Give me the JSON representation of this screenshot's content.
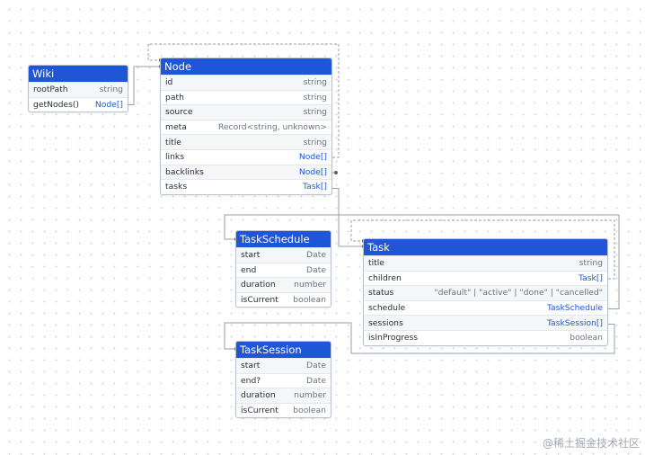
{
  "entities": {
    "wiki": {
      "title": "Wiki",
      "fields": [
        {
          "name": "rootPath",
          "type": "string"
        },
        {
          "name": "getNodes()",
          "type": "Node[]"
        }
      ]
    },
    "node": {
      "title": "Node",
      "fields": [
        {
          "name": "id",
          "type": "string"
        },
        {
          "name": "path",
          "type": "string"
        },
        {
          "name": "source",
          "type": "string"
        },
        {
          "name": "meta",
          "type": "Record<string, unknown>"
        },
        {
          "name": "title",
          "type": "string"
        },
        {
          "name": "links",
          "type": "Node[]"
        },
        {
          "name": "backlinks",
          "type": "Node[]"
        },
        {
          "name": "tasks",
          "type": "Task[]"
        }
      ]
    },
    "task_schedule": {
      "title": "TaskSchedule",
      "fields": [
        {
          "name": "start",
          "type": "Date"
        },
        {
          "name": "end",
          "type": "Date"
        },
        {
          "name": "duration",
          "type": "number"
        },
        {
          "name": "isCurrent",
          "type": "boolean"
        }
      ]
    },
    "task": {
      "title": "Task",
      "fields": [
        {
          "name": "title",
          "type": "string"
        },
        {
          "name": "children",
          "type": "Task[]"
        },
        {
          "name": "status",
          "type": "\"default\" | \"active\" | \"done\" | \"cancelled\""
        },
        {
          "name": "schedule",
          "type": "TaskSchedule"
        },
        {
          "name": "sessions",
          "type": "TaskSession[]"
        },
        {
          "name": "isInProgress",
          "type": "boolean"
        }
      ]
    },
    "task_session": {
      "title": "TaskSession",
      "fields": [
        {
          "name": "start",
          "type": "Date"
        },
        {
          "name": "end?",
          "type": "Date"
        },
        {
          "name": "duration",
          "type": "number"
        },
        {
          "name": "isCurrent",
          "type": "boolean"
        }
      ]
    }
  },
  "reference_types": [
    "Node[]",
    "Task[]",
    "TaskSchedule",
    "TaskSession[]"
  ],
  "colors": {
    "header": "#1f56d6",
    "reference_type": "#1f56d6",
    "edge": "#9aa1ab"
  },
  "watermark": "@稀土掘金技术社区"
}
